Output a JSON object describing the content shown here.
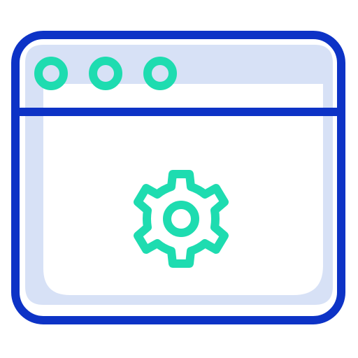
{
  "icon": {
    "name": "browser-settings-icon",
    "window_dots": [
      "window-dot",
      "window-dot",
      "window-dot"
    ],
    "center_icon": "gear-icon"
  },
  "colors": {
    "outline": "#0d33c6",
    "fill": "#d7e1f6",
    "accent": "#1edcb0",
    "background": "#ffffff"
  }
}
